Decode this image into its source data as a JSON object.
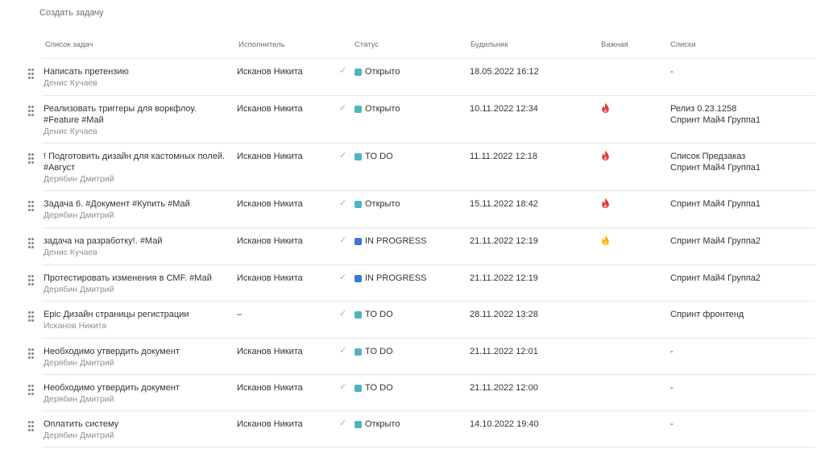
{
  "create_task": "Создать задачу",
  "columns": {
    "task_list": "Список задач",
    "assignee": "Исполнитель",
    "status": "Статус",
    "alarm": "Будильник",
    "important": "Важная",
    "lists": "Списки"
  },
  "colors": {
    "status_teal": "#4fb5bd",
    "status_blue": "#3a78d6",
    "fire_red": "#e53935",
    "fire_yellow": "#f5b800"
  },
  "rows": [
    {
      "title": "Написать претензию",
      "author": "Денис Кучаев",
      "assignee": "Исканов Никита",
      "status": "Открыто",
      "status_color": "teal",
      "alarm": "18.05.2022 16:12",
      "important": "none",
      "lists": "-"
    },
    {
      "title": "Реализовать триггеры для воркфлоу. #Feature #Май",
      "author": "Денис Кучаев",
      "assignee": "Исканов Никита",
      "status": "Открыто",
      "status_color": "teal",
      "alarm": "10.11.2022 12:34",
      "important": "red",
      "lists": "Релиз 0.23.1258\nСпринт Май4 Группа1"
    },
    {
      "title": "! Подготовить дизайн для кастомных полей. #Август",
      "author": "Дерябин Дмитрий",
      "assignee": "Исканов Никита",
      "status": "TO DO",
      "status_color": "teal",
      "alarm": "11.11.2022 12:18",
      "important": "red",
      "lists": "Список Предзаказ\nСпринт Май4 Группа1"
    },
    {
      "title": "Задача 6. #Документ #Купить #Май",
      "author": "Дерябин Дмитрий",
      "assignee": "Исканов Никита",
      "status": "Открыто",
      "status_color": "teal",
      "alarm": "15.11.2022 18:42",
      "important": "red",
      "lists": "Спринт Май4 Группа1"
    },
    {
      "title": "задача на разработку!. #Май",
      "author": "Денис Кучаев",
      "assignee": "Исканов Никита",
      "status": "IN PROGRESS",
      "status_color": "blue",
      "alarm": "21.11.2022 12:19",
      "important": "yellow",
      "lists": "Спринт Май4 Группа2"
    },
    {
      "title": "Протестировать изменения в CMF. #Май",
      "author": "Дерябин Дмитрий",
      "assignee": "Исканов Никита",
      "status": "IN PROGRESS",
      "status_color": "blue",
      "alarm": "21.11.2022 12:19",
      "important": "none",
      "lists": "Спринт Май4 Группа2"
    },
    {
      "title": "Epic Дизайн страницы регистрации",
      "author": "Исканов Никита",
      "assignee": "–",
      "status": "TO DO",
      "status_color": "teal",
      "alarm": "28.11.2022 13:28",
      "important": "none",
      "lists": "Спринт фронтенд"
    },
    {
      "title": "Необходимо утвердить документ",
      "author": "Дерябин Дмитрий",
      "assignee": "Исканов Никита",
      "status": "TO DO",
      "status_color": "teal",
      "alarm": "21.11.2022 12:01",
      "important": "none",
      "lists": "-"
    },
    {
      "title": "Необходимо утвердить документ",
      "author": "Дерябин Дмитрий",
      "assignee": "Исканов Никита",
      "status": "TO DO",
      "status_color": "teal",
      "alarm": "21.11.2022 12:00",
      "important": "none",
      "lists": "-"
    },
    {
      "title": "Оплатить систему",
      "author": "Дерябин Дмитрий",
      "assignee": "Исканов Никита",
      "status": "Открыто",
      "status_color": "teal",
      "alarm": "14.10.2022 19:40",
      "important": "none",
      "lists": "-"
    }
  ]
}
